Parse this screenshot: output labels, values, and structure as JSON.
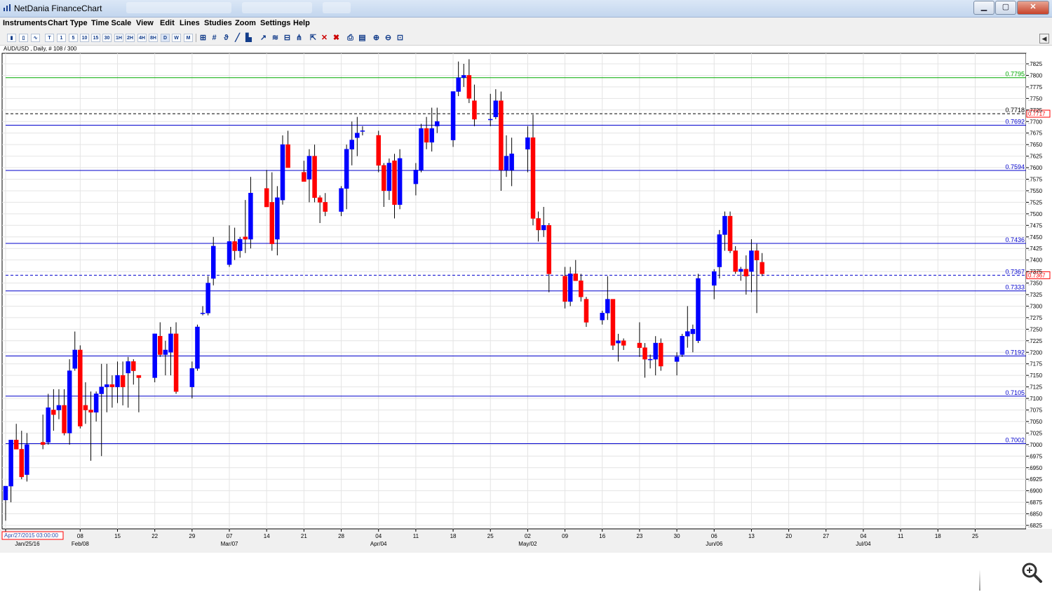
{
  "window": {
    "title": "NetDania FinanceChart",
    "minimize": "▁",
    "maximize": "▢",
    "close": "✕"
  },
  "menu": [
    "Instruments",
    "Chart Type",
    "Time Scale",
    "View",
    "Edit",
    "Lines",
    "Studies",
    "Zoom",
    "Settings",
    "Help"
  ],
  "toolbar_buttons": [
    {
      "name": "bar-chart-icon",
      "label": ""
    },
    {
      "name": "candle-chart-icon",
      "label": ""
    },
    {
      "name": "line-chart-icon",
      "label": ""
    },
    {
      "name": "timescale-tick",
      "label": "T"
    },
    {
      "name": "timescale-1",
      "label": "1"
    },
    {
      "name": "timescale-5",
      "label": "5"
    },
    {
      "name": "timescale-10",
      "label": "10"
    },
    {
      "name": "timescale-15",
      "label": "15"
    },
    {
      "name": "timescale-30",
      "label": "30"
    },
    {
      "name": "timescale-1h",
      "label": "1H"
    },
    {
      "name": "timescale-2h",
      "label": "2H"
    },
    {
      "name": "timescale-4h",
      "label": "4H"
    },
    {
      "name": "timescale-8h",
      "label": "8H"
    },
    {
      "name": "timescale-d",
      "label": "D"
    },
    {
      "name": "timescale-w",
      "label": "W"
    },
    {
      "name": "timescale-m",
      "label": "M"
    }
  ],
  "icons": {
    "crosshair": "crosshair-icon",
    "grid": "#",
    "print": "print-icon",
    "zoom_in": "zoom-in-icon",
    "zoom_out": "zoom-out-icon",
    "delete": "✕",
    "side_toggle": "◀"
  },
  "colors": {
    "bull": "#0000ff",
    "bear": "#ff0000",
    "hline": "#0000cc",
    "green_line": "#00aa00",
    "dashed": "#000000",
    "grid": "#e4e4e4",
    "axis_text": "#000000",
    "date_box": "#ff0000"
  },
  "chart_data": {
    "type": "candlestick",
    "instrument": "AUD/USD",
    "header": "AUD/USD , Daily, # 108 / 300",
    "ylim": [
      0.681,
      0.7845
    ],
    "y_ticks": [
      0.6825,
      0.685,
      0.6875,
      0.69,
      0.6925,
      0.695,
      0.6975,
      0.7,
      0.7025,
      0.705,
      0.7075,
      0.71,
      0.7125,
      0.715,
      0.7175,
      0.72,
      0.7225,
      0.725,
      0.7275,
      0.73,
      0.7325,
      0.735,
      0.7375,
      0.74,
      0.7425,
      0.745,
      0.7475,
      0.75,
      0.7525,
      0.755,
      0.7575,
      0.76,
      0.7625,
      0.765,
      0.7675,
      0.77,
      0.7725,
      0.775,
      0.7775,
      0.78,
      0.7825
    ],
    "x_ticks": [
      {
        "day": 0,
        "label": "Jan/25/16"
      },
      {
        "day": 14,
        "label": "08"
      },
      {
        "day": 21,
        "label": "15"
      },
      {
        "day": 28,
        "label": "22"
      },
      {
        "day": 35,
        "label": "29"
      },
      {
        "day": 42,
        "label": "07"
      },
      {
        "day": 49,
        "label": "14"
      },
      {
        "day": 56,
        "label": "21"
      },
      {
        "day": 63,
        "label": "28"
      },
      {
        "day": 70,
        "label": "04"
      },
      {
        "day": 77,
        "label": "11"
      },
      {
        "day": 84,
        "label": "18"
      },
      {
        "day": 91,
        "label": "25"
      },
      {
        "day": 98,
        "label": "02"
      },
      {
        "day": 105,
        "label": "09"
      },
      {
        "day": 112,
        "label": "16"
      },
      {
        "day": 119,
        "label": "23"
      },
      {
        "day": 126,
        "label": "30"
      },
      {
        "day": 133,
        "label": "06"
      },
      {
        "day": 140,
        "label": "13"
      },
      {
        "day": 147,
        "label": "20"
      },
      {
        "day": 154,
        "label": "27"
      },
      {
        "day": 161,
        "label": "04"
      },
      {
        "day": 168,
        "label": "11"
      },
      {
        "day": 175,
        "label": "18"
      },
      {
        "day": 182,
        "label": "25"
      }
    ],
    "month_labels": [
      {
        "day": 14,
        "label": "Feb/08"
      },
      {
        "day": 42,
        "label": "Mar/07"
      },
      {
        "day": 70,
        "label": "Apr/04"
      },
      {
        "day": 98,
        "label": "May/02"
      },
      {
        "day": 133,
        "label": "Jun/06"
      },
      {
        "day": 161,
        "label": "Jul/04"
      }
    ],
    "cursor_date": "Apr/27/2015 03:00:00",
    "hlines": [
      {
        "value": 0.7795,
        "label": "0.7795",
        "color": "green"
      },
      {
        "value": 0.7692,
        "label": "0.7692",
        "color": "blue"
      },
      {
        "value": 0.7594,
        "label": "0.7594",
        "color": "blue"
      },
      {
        "value": 0.7436,
        "label": "0.7436",
        "color": "blue"
      },
      {
        "value": 0.7333,
        "label": "0.7333",
        "color": "blue"
      },
      {
        "value": 0.7192,
        "label": "0.7192",
        "color": "blue"
      },
      {
        "value": 0.7105,
        "label": "0.7105",
        "color": "blue"
      },
      {
        "value": 0.7002,
        "label": "0.7002",
        "color": "blue"
      }
    ],
    "dashed_lines": [
      {
        "value": 0.7717,
        "label": "0.7718",
        "box_label": "0.7717",
        "style": "black"
      },
      {
        "value": 0.7367,
        "label": "0.7367",
        "box_label": "0.7367",
        "style": "blue"
      }
    ],
    "candles": [
      {
        "d": 0,
        "o": 0.688,
        "h": 0.6905,
        "l": 0.6835,
        "c": 0.691
      },
      {
        "d": 1,
        "o": 0.691,
        "h": 0.701,
        "l": 0.6875,
        "c": 0.701
      },
      {
        "d": 2,
        "o": 0.701,
        "h": 0.7045,
        "l": 0.699,
        "c": 0.699
      },
      {
        "d": 3,
        "o": 0.699,
        "h": 0.703,
        "l": 0.6925,
        "c": 0.693
      },
      {
        "d": 4,
        "o": 0.6935,
        "h": 0.7025,
        "l": 0.692,
        "c": 0.7
      },
      {
        "d": 7,
        "o": 0.7005,
        "h": 0.7065,
        "l": 0.699,
        "c": 0.7
      },
      {
        "d": 8,
        "o": 0.7005,
        "h": 0.711,
        "l": 0.7,
        "c": 0.708
      },
      {
        "d": 9,
        "o": 0.7075,
        "h": 0.712,
        "l": 0.703,
        "c": 0.7065
      },
      {
        "d": 10,
        "o": 0.7075,
        "h": 0.712,
        "l": 0.7055,
        "c": 0.7085
      },
      {
        "d": 11,
        "o": 0.7085,
        "h": 0.712,
        "l": 0.702,
        "c": 0.7025
      },
      {
        "d": 12,
        "o": 0.7025,
        "h": 0.7185,
        "l": 0.7,
        "c": 0.716
      },
      {
        "d": 13,
        "o": 0.7165,
        "h": 0.7245,
        "l": 0.716,
        "c": 0.7205
      },
      {
        "d": 14,
        "o": 0.7205,
        "h": 0.7215,
        "l": 0.7035,
        "c": 0.704
      },
      {
        "d": 15,
        "o": 0.7085,
        "h": 0.7135,
        "l": 0.7045,
        "c": 0.7075
      },
      {
        "d": 16,
        "o": 0.7075,
        "h": 0.7115,
        "l": 0.6965,
        "c": 0.707
      },
      {
        "d": 17,
        "o": 0.707,
        "h": 0.7115,
        "l": 0.705,
        "c": 0.711
      },
      {
        "d": 18,
        "o": 0.711,
        "h": 0.7175,
        "l": 0.6975,
        "c": 0.7125
      },
      {
        "d": 19,
        "o": 0.7125,
        "h": 0.7175,
        "l": 0.707,
        "c": 0.713
      },
      {
        "d": 20,
        "o": 0.713,
        "h": 0.715,
        "l": 0.708,
        "c": 0.7125
      },
      {
        "d": 21,
        "o": 0.7125,
        "h": 0.718,
        "l": 0.709,
        "c": 0.715
      },
      {
        "d": 22,
        "o": 0.715,
        "h": 0.718,
        "l": 0.7085,
        "c": 0.7125
      },
      {
        "d": 23,
        "o": 0.7155,
        "h": 0.719,
        "l": 0.708,
        "c": 0.718
      },
      {
        "d": 24,
        "o": 0.718,
        "h": 0.7185,
        "l": 0.713,
        "c": 0.716
      },
      {
        "d": 25,
        "o": 0.715,
        "h": 0.715,
        "l": 0.707,
        "c": 0.7145
      },
      {
        "d": 28,
        "o": 0.7145,
        "h": 0.724,
        "l": 0.7135,
        "c": 0.724
      },
      {
        "d": 29,
        "o": 0.7235,
        "h": 0.7265,
        "l": 0.719,
        "c": 0.7195
      },
      {
        "d": 30,
        "o": 0.7195,
        "h": 0.7225,
        "l": 0.715,
        "c": 0.7205
      },
      {
        "d": 31,
        "o": 0.72,
        "h": 0.7255,
        "l": 0.715,
        "c": 0.724
      },
      {
        "d": 32,
        "o": 0.724,
        "h": 0.7265,
        "l": 0.711,
        "c": 0.7115
      },
      {
        "d": 35,
        "o": 0.7125,
        "h": 0.718,
        "l": 0.71,
        "c": 0.7165
      },
      {
        "d": 36,
        "o": 0.7165,
        "h": 0.726,
        "l": 0.716,
        "c": 0.7255
      },
      {
        "d": 37,
        "o": 0.7285,
        "h": 0.73,
        "l": 0.728,
        "c": 0.7285
      },
      {
        "d": 38,
        "o": 0.7285,
        "h": 0.7365,
        "l": 0.728,
        "c": 0.735
      },
      {
        "d": 39,
        "o": 0.736,
        "h": 0.745,
        "l": 0.7345,
        "c": 0.743
      },
      {
        "d": 42,
        "o": 0.739,
        "h": 0.7475,
        "l": 0.7385,
        "c": 0.744
      },
      {
        "d": 43,
        "o": 0.744,
        "h": 0.747,
        "l": 0.74,
        "c": 0.742
      },
      {
        "d": 44,
        "o": 0.742,
        "h": 0.745,
        "l": 0.7405,
        "c": 0.7445
      },
      {
        "d": 45,
        "o": 0.745,
        "h": 0.753,
        "l": 0.7415,
        "c": 0.7445
      },
      {
        "d": 46,
        "o": 0.7445,
        "h": 0.758,
        "l": 0.7425,
        "c": 0.7545
      },
      {
        "d": 49,
        "o": 0.7555,
        "h": 0.7595,
        "l": 0.7515,
        "c": 0.7515
      },
      {
        "d": 50,
        "o": 0.7525,
        "h": 0.759,
        "l": 0.742,
        "c": 0.7435
      },
      {
        "d": 51,
        "o": 0.7445,
        "h": 0.756,
        "l": 0.741,
        "c": 0.7535
      },
      {
        "d": 52,
        "o": 0.753,
        "h": 0.767,
        "l": 0.752,
        "c": 0.765
      },
      {
        "d": 53,
        "o": 0.765,
        "h": 0.768,
        "l": 0.76,
        "c": 0.76
      },
      {
        "d": 56,
        "o": 0.759,
        "h": 0.7615,
        "l": 0.757,
        "c": 0.757
      },
      {
        "d": 57,
        "o": 0.7575,
        "h": 0.764,
        "l": 0.7525,
        "c": 0.7625
      },
      {
        "d": 58,
        "o": 0.7625,
        "h": 0.765,
        "l": 0.7525,
        "c": 0.7535
      },
      {
        "d": 59,
        "o": 0.7535,
        "h": 0.754,
        "l": 0.748,
        "c": 0.7525
      },
      {
        "d": 60,
        "o": 0.7525,
        "h": 0.7545,
        "l": 0.7495,
        "c": 0.7505
      },
      {
        "d": 63,
        "o": 0.7505,
        "h": 0.756,
        "l": 0.7495,
        "c": 0.7555
      },
      {
        "d": 64,
        "o": 0.7555,
        "h": 0.765,
        "l": 0.751,
        "c": 0.764
      },
      {
        "d": 65,
        "o": 0.764,
        "h": 0.77,
        "l": 0.7605,
        "c": 0.766
      },
      {
        "d": 66,
        "o": 0.7665,
        "h": 0.771,
        "l": 0.7625,
        "c": 0.7675
      },
      {
        "d": 67,
        "o": 0.768,
        "h": 0.769,
        "l": 0.767,
        "c": 0.768
      },
      {
        "d": 70,
        "o": 0.767,
        "h": 0.768,
        "l": 0.759,
        "c": 0.7605
      },
      {
        "d": 71,
        "o": 0.7605,
        "h": 0.761,
        "l": 0.7515,
        "c": 0.755
      },
      {
        "d": 72,
        "o": 0.755,
        "h": 0.762,
        "l": 0.753,
        "c": 0.761
      },
      {
        "d": 73,
        "o": 0.7615,
        "h": 0.763,
        "l": 0.749,
        "c": 0.752
      },
      {
        "d": 74,
        "o": 0.752,
        "h": 0.764,
        "l": 0.751,
        "c": 0.762
      },
      {
        "d": 77,
        "o": 0.7565,
        "h": 0.761,
        "l": 0.754,
        "c": 0.7595
      },
      {
        "d": 78,
        "o": 0.7595,
        "h": 0.7695,
        "l": 0.759,
        "c": 0.7685
      },
      {
        "d": 79,
        "o": 0.7685,
        "h": 0.771,
        "l": 0.764,
        "c": 0.7655
      },
      {
        "d": 80,
        "o": 0.7655,
        "h": 0.773,
        "l": 0.7635,
        "c": 0.7685
      },
      {
        "d": 81,
        "o": 0.769,
        "h": 0.773,
        "l": 0.7675,
        "c": 0.77
      },
      {
        "d": 84,
        "o": 0.766,
        "h": 0.7765,
        "l": 0.7645,
        "c": 0.7765
      },
      {
        "d": 85,
        "o": 0.7765,
        "h": 0.783,
        "l": 0.7755,
        "c": 0.7795
      },
      {
        "d": 86,
        "o": 0.7795,
        "h": 0.7825,
        "l": 0.7775,
        "c": 0.78
      },
      {
        "d": 87,
        "o": 0.78,
        "h": 0.7835,
        "l": 0.774,
        "c": 0.775
      },
      {
        "d": 88,
        "o": 0.7745,
        "h": 0.778,
        "l": 0.769,
        "c": 0.7705
      },
      {
        "d": 91,
        "o": 0.7705,
        "h": 0.776,
        "l": 0.769,
        "c": 0.7705
      },
      {
        "d": 92,
        "o": 0.771,
        "h": 0.777,
        "l": 0.7705,
        "c": 0.7745
      },
      {
        "d": 93,
        "o": 0.7745,
        "h": 0.7765,
        "l": 0.755,
        "c": 0.7595
      },
      {
        "d": 94,
        "o": 0.7595,
        "h": 0.767,
        "l": 0.758,
        "c": 0.7625
      },
      {
        "d": 95,
        "o": 0.7595,
        "h": 0.7665,
        "l": 0.756,
        "c": 0.763
      },
      {
        "d": 98,
        "o": 0.764,
        "h": 0.769,
        "l": 0.759,
        "c": 0.7665
      },
      {
        "d": 99,
        "o": 0.7665,
        "h": 0.7715,
        "l": 0.7475,
        "c": 0.749
      },
      {
        "d": 100,
        "o": 0.749,
        "h": 0.7505,
        "l": 0.744,
        "c": 0.7465
      },
      {
        "d": 101,
        "o": 0.7465,
        "h": 0.7515,
        "l": 0.745,
        "c": 0.7475
      },
      {
        "d": 102,
        "o": 0.7475,
        "h": 0.748,
        "l": 0.733,
        "c": 0.737
      },
      {
        "d": 105,
        "o": 0.7365,
        "h": 0.7385,
        "l": 0.7295,
        "c": 0.731
      },
      {
        "d": 106,
        "o": 0.731,
        "h": 0.7385,
        "l": 0.73,
        "c": 0.737
      },
      {
        "d": 107,
        "o": 0.737,
        "h": 0.74,
        "l": 0.7355,
        "c": 0.7355
      },
      {
        "d": 108,
        "o": 0.7355,
        "h": 0.737,
        "l": 0.731,
        "c": 0.732
      },
      {
        "d": 109,
        "o": 0.7315,
        "h": 0.732,
        "l": 0.7255,
        "c": 0.7265
      },
      {
        "d": 112,
        "o": 0.727,
        "h": 0.729,
        "l": 0.726,
        "c": 0.7285
      },
      {
        "d": 113,
        "o": 0.7285,
        "h": 0.7365,
        "l": 0.727,
        "c": 0.7315
      },
      {
        "d": 114,
        "o": 0.7315,
        "h": 0.7315,
        "l": 0.7205,
        "c": 0.7215
      },
      {
        "d": 115,
        "o": 0.722,
        "h": 0.724,
        "l": 0.718,
        "c": 0.7225
      },
      {
        "d": 116,
        "o": 0.7225,
        "h": 0.723,
        "l": 0.7205,
        "c": 0.7215
      },
      {
        "d": 119,
        "o": 0.722,
        "h": 0.7265,
        "l": 0.719,
        "c": 0.721
      },
      {
        "d": 120,
        "o": 0.721,
        "h": 0.722,
        "l": 0.7145,
        "c": 0.7185
      },
      {
        "d": 121,
        "o": 0.7185,
        "h": 0.7195,
        "l": 0.7165,
        "c": 0.7185
      },
      {
        "d": 122,
        "o": 0.7185,
        "h": 0.7235,
        "l": 0.715,
        "c": 0.722
      },
      {
        "d": 123,
        "o": 0.722,
        "h": 0.723,
        "l": 0.716,
        "c": 0.717
      },
      {
        "d": 126,
        "o": 0.718,
        "h": 0.72,
        "l": 0.715,
        "c": 0.719
      },
      {
        "d": 127,
        "o": 0.7195,
        "h": 0.724,
        "l": 0.719,
        "c": 0.7235
      },
      {
        "d": 128,
        "o": 0.7235,
        "h": 0.73,
        "l": 0.721,
        "c": 0.7245
      },
      {
        "d": 129,
        "o": 0.724,
        "h": 0.726,
        "l": 0.72,
        "c": 0.725
      },
      {
        "d": 130,
        "o": 0.7225,
        "h": 0.737,
        "l": 0.722,
        "c": 0.736
      },
      {
        "d": 133,
        "o": 0.7345,
        "h": 0.738,
        "l": 0.7315,
        "c": 0.7375
      },
      {
        "d": 134,
        "o": 0.7385,
        "h": 0.7465,
        "l": 0.736,
        "c": 0.7455
      },
      {
        "d": 135,
        "o": 0.7455,
        "h": 0.7505,
        "l": 0.742,
        "c": 0.7495
      },
      {
        "d": 136,
        "o": 0.7495,
        "h": 0.7505,
        "l": 0.7415,
        "c": 0.742
      },
      {
        "d": 137,
        "o": 0.742,
        "h": 0.743,
        "l": 0.737,
        "c": 0.7375
      },
      {
        "d": 138,
        "o": 0.7375,
        "h": 0.7385,
        "l": 0.7355,
        "c": 0.738
      },
      {
        "d": 139,
        "o": 0.738,
        "h": 0.741,
        "l": 0.7325,
        "c": 0.7365
      },
      {
        "d": 140,
        "o": 0.7375,
        "h": 0.7445,
        "l": 0.733,
        "c": 0.742
      },
      {
        "d": 141,
        "o": 0.742,
        "h": 0.7435,
        "l": 0.7285,
        "c": 0.74
      },
      {
        "d": 142,
        "o": 0.7395,
        "h": 0.7415,
        "l": 0.7365,
        "c": 0.737
      }
    ]
  }
}
